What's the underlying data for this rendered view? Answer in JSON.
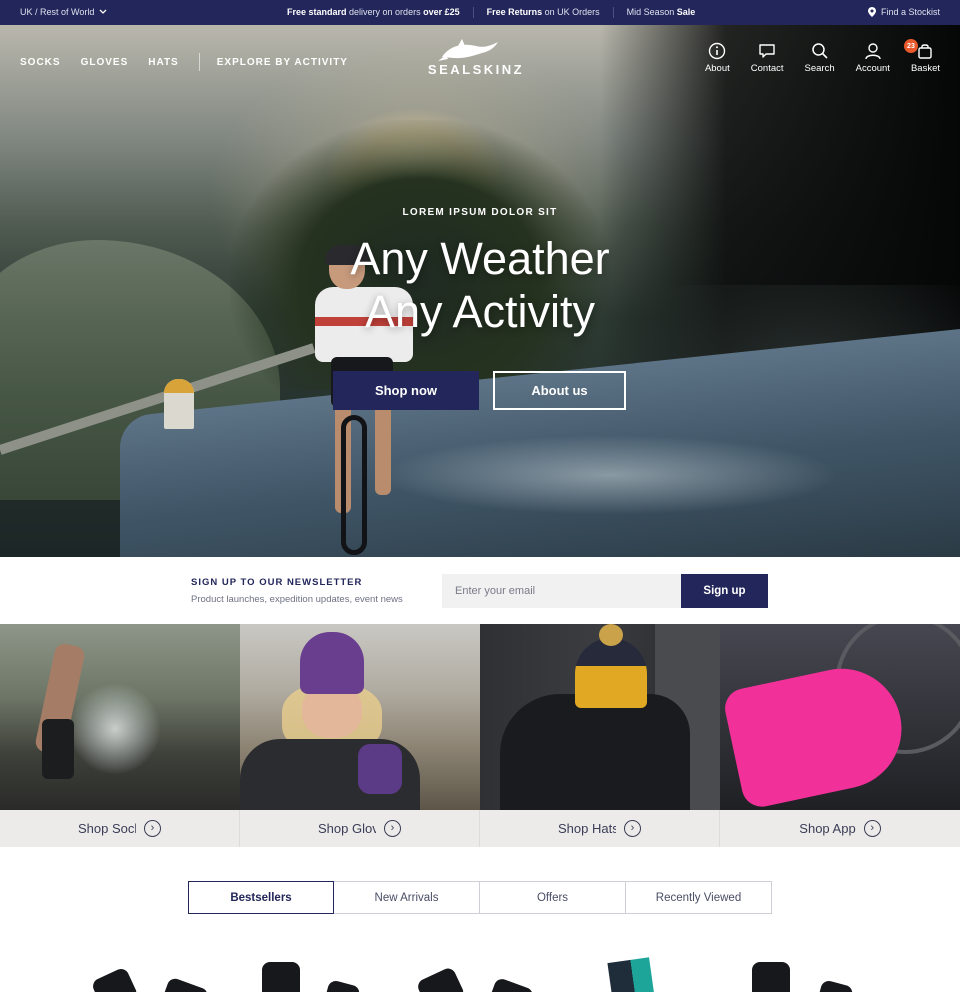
{
  "topbar": {
    "region": "UK / Rest of World",
    "promos": [
      {
        "bold": "Free standard",
        "text": " delivery on orders ",
        "bold2": "over £25"
      },
      {
        "bold": "Free Returns",
        "text": " on UK Orders",
        "bold2": ""
      },
      {
        "bold": "",
        "text": "Mid Season ",
        "bold2": "Sale"
      }
    ],
    "stockist": "Find a Stockist"
  },
  "nav": {
    "links": [
      "SOCKS",
      "GLOVES",
      "HATS"
    ],
    "explore": "EXPLORE BY ACTIVITY"
  },
  "logo": {
    "text": "SEALSKINZ"
  },
  "header_icons": [
    {
      "name": "info-icon",
      "label": "About"
    },
    {
      "name": "chat-icon",
      "label": "Contact"
    },
    {
      "name": "search-icon",
      "label": "Search"
    },
    {
      "name": "account-icon",
      "label": "Account"
    },
    {
      "name": "basket-icon",
      "label": "Basket",
      "badge": "23"
    }
  ],
  "hero": {
    "eyebrow": "LOREM IPSUM DOLOR SIT",
    "title_line1": "Any Weather",
    "title_line2": "Any Activity",
    "primary_button": "Shop now",
    "secondary_button": "About us"
  },
  "newsletter": {
    "title": "SIGN UP TO OUR NEWSLETTER",
    "subtitle": "Product launches, expedition updates, event news",
    "placeholder": "Enter your email",
    "button": "Sign up"
  },
  "categories": [
    {
      "label": "Shop Socks"
    },
    {
      "label": "Shop Gloves"
    },
    {
      "label": "Shop Hats"
    },
    {
      "label": "Shop App"
    }
  ],
  "tabs": [
    {
      "label": "Bestsellers",
      "active": true
    },
    {
      "label": "New Arrivals",
      "active": false
    },
    {
      "label": "Offers",
      "active": false
    },
    {
      "label": "Recently Viewed",
      "active": false
    }
  ],
  "colors": {
    "brand_navy": "#22265a",
    "badge_orange": "#e8582a",
    "tile_bar": "#ecebea"
  }
}
